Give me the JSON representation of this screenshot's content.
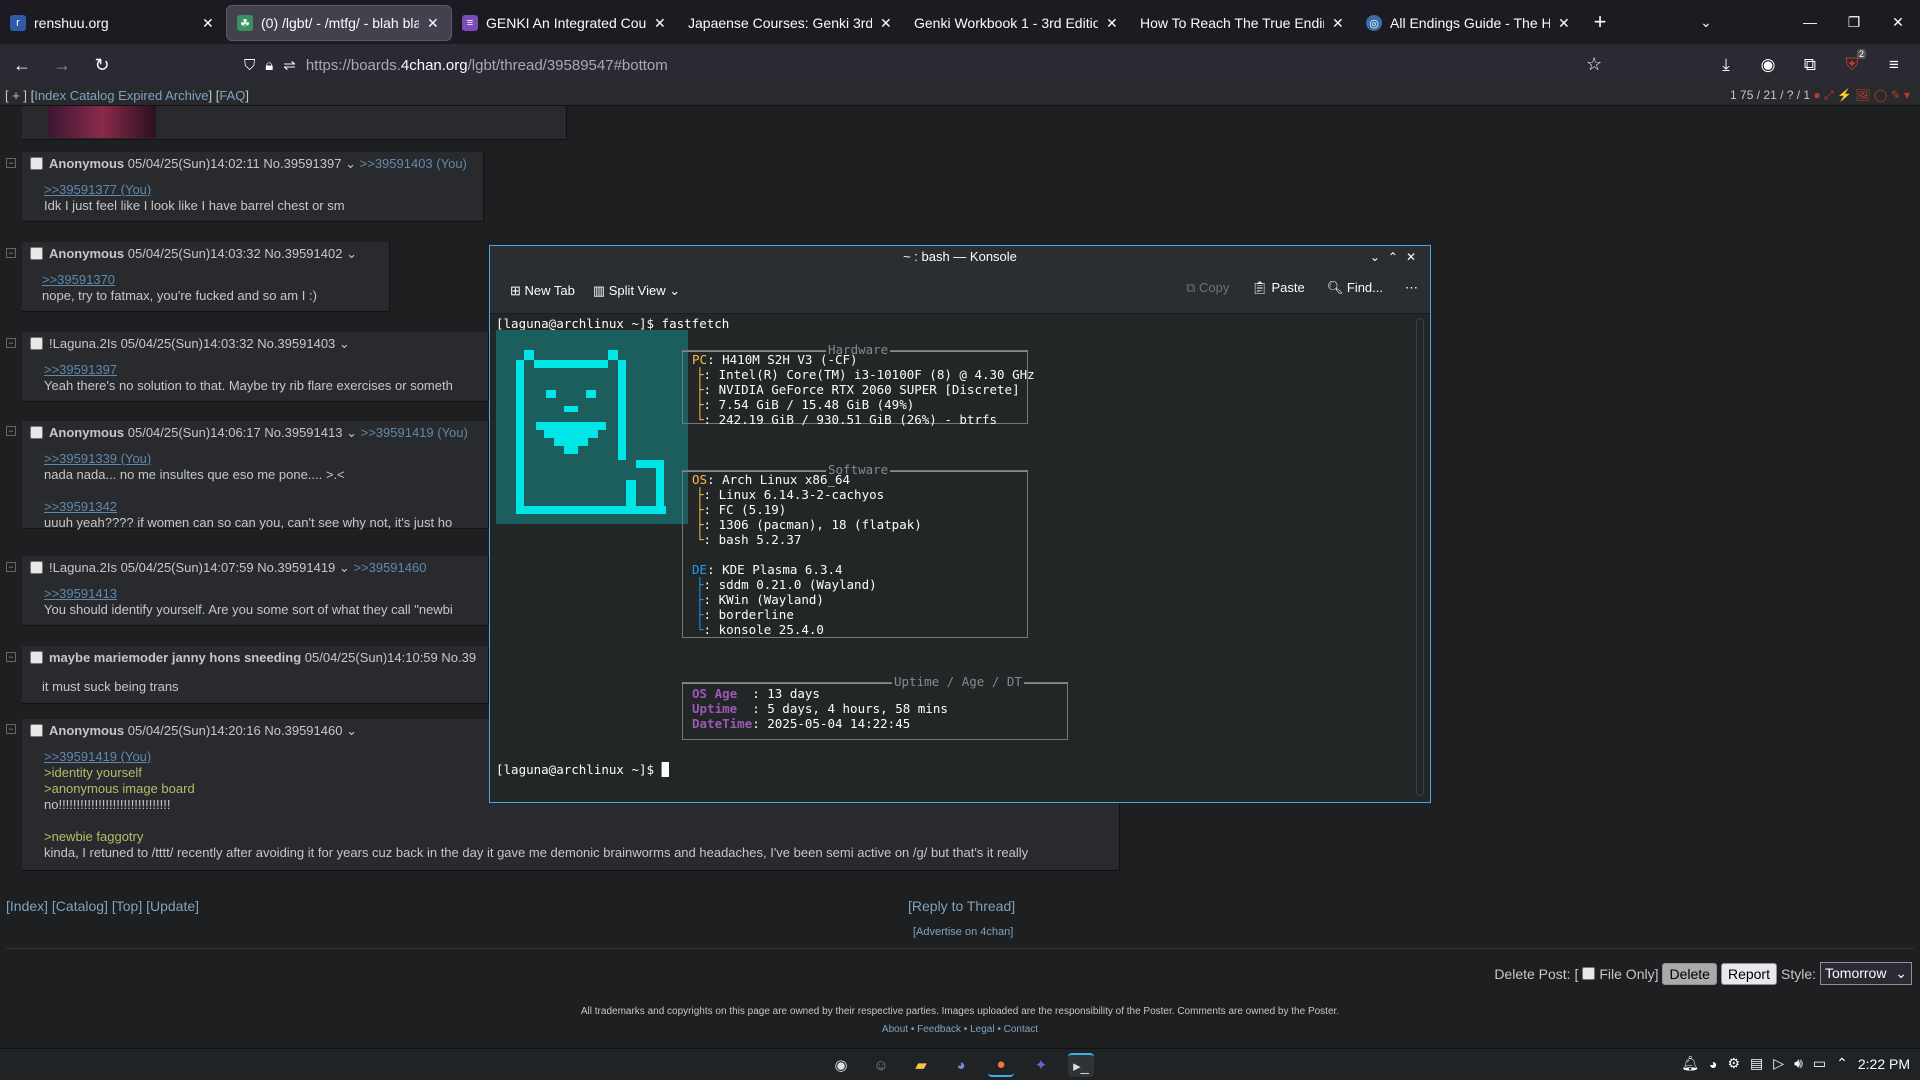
{
  "tabs": [
    {
      "label": "renshuu.org",
      "active": false
    },
    {
      "label": "(0) /lgbt/ - /mtfg/ - blah bla",
      "active": true
    },
    {
      "label": "GENKI An Integrated Cour",
      "active": false
    },
    {
      "label": "Japaense Courses: Genki 3rd e",
      "active": false
    },
    {
      "label": "Genki Workbook 1 - 3rd Edition",
      "active": false
    },
    {
      "label": "How To Reach The True Ending",
      "active": false
    },
    {
      "label": "All Endings Guide - The Hu",
      "active": false
    }
  ],
  "url": {
    "prefix": "https://boards.",
    "domain": "4chan.org",
    "path": "/lgbt/thread/39589547#bottom"
  },
  "topnav": {
    "left_open": "[ + ] [",
    "index": "Index",
    "catalog": "Catalog",
    "expired": "Expired",
    "archive": "Archive",
    "mid": "] [",
    "faq": "FAQ",
    "close": "]",
    "stats": "1 75 / 21 / ? / 1"
  },
  "posts": [
    {
      "name": "Anonymous",
      "date": "05/04/25(Sun)14:02:11",
      "no": "No.39591397",
      "backlinks": ">>39591403 (You)",
      "lines": [
        {
          "t": ">>39591377 (You)",
          "k": "ql"
        },
        {
          "t": "Idk I just feel like I look like I have barrel chest or sm",
          "k": "txt"
        }
      ]
    },
    {
      "name": "Anonymous",
      "date": "05/04/25(Sun)14:03:32",
      "no": "No.39591402",
      "backlinks": "",
      "lines": [
        {
          "t": ">>39591370",
          "k": "ql"
        },
        {
          "t": "nope, try to fatmax, you're fucked and so am I :)",
          "k": "txt"
        }
      ]
    },
    {
      "name": "!Laguna.2Is",
      "date": "05/04/25(Sun)14:03:32",
      "no": "No.39591403",
      "backlinks": "",
      "lines": [
        {
          "t": ">>39591397",
          "k": "ql"
        },
        {
          "t": "Yeah there's no solution to that. Maybe try rib flare exercises or someth",
          "k": "txt"
        }
      ]
    },
    {
      "name": "Anonymous",
      "date": "05/04/25(Sun)14:06:17",
      "no": "No.39591413",
      "backlinks": ">>39591419 (You)",
      "lines": [
        {
          "t": ">>39591339 (You)",
          "k": "ql"
        },
        {
          "t": "nada nada... no me insultes que eso me pone.... >.<",
          "k": "txt"
        },
        {
          "t": "",
          "k": "txt"
        },
        {
          "t": ">>39591342",
          "k": "ql"
        },
        {
          "t": "uuuh yeah???? if women can so can you, can't see why not, it's just ho",
          "k": "txt"
        }
      ]
    },
    {
      "name": "!Laguna.2Is",
      "date": "05/04/25(Sun)14:07:59",
      "no": "No.39591419",
      "backlinks": ">>39591460",
      "lines": [
        {
          "t": ">>39591413",
          "k": "ql"
        },
        {
          "t": "You should identify yourself. Are you some sort of what they call \"newbi",
          "k": "txt"
        }
      ]
    },
    {
      "name": "maybe mariemoder janny hons sneeding",
      "date": "05/04/25(Sun)14:10:59",
      "no": "No.39",
      "backlinks": "",
      "lines": [
        {
          "t": "it must suck being trans",
          "k": "txt"
        }
      ]
    },
    {
      "name": "Anonymous",
      "date": "05/04/25(Sun)14:20:16",
      "no": "No.39591460",
      "backlinks": "",
      "lines": [
        {
          "t": ">>39591419 (You)",
          "k": "ql"
        },
        {
          "t": ">identity yourself",
          "k": "gt"
        },
        {
          "t": ">anonymous image board",
          "k": "gt"
        },
        {
          "t": "no!!!!!!!!!!!!!!!!!!!!!!!!!!!!!!!",
          "k": "txt"
        },
        {
          "t": "",
          "k": "txt"
        },
        {
          "t": ">newbie faggotry",
          "k": "gt"
        },
        {
          "t": "kinda, I retuned to /tttt/ recently after avoiding it for years cuz back in the day it gave me demonic brainworms and headaches, I've been semi active on /g/ but that's it really",
          "k": "txt"
        }
      ]
    }
  ],
  "bottom": {
    "index": "[Index]",
    "catalog": "[Catalog]",
    "top": "[Top]",
    "update": "[Update]",
    "reply": "[Reply to Thread]",
    "advertise": "[Advertise on 4chan]",
    "delete_post": "Delete Post: [",
    "file_only": "File Only]",
    "delete": "Delete",
    "report": "Report",
    "style_label": "Style:",
    "style_value": "Tomorrow",
    "legal": "All trademarks and copyrights on this page are owned by their respective parties. Images uploaded are the responsibility of the Poster. Comments are owned by the Poster.",
    "footer_links": "About • Feedback • Legal • Contact"
  },
  "konsole": {
    "title": "~ : bash — Konsole",
    "toolbar": {
      "new_tab": "New Tab",
      "split_view": "Split View",
      "copy": "Copy",
      "paste": "Paste",
      "find": "Find..."
    },
    "prompt1": "[laguna@archlinux ~]$ fastfetch",
    "prompt2": "[laguna@archlinux ~]$ ",
    "hw_title": "Hardware",
    "hw": [
      {
        "k": "PC",
        "v": ": H410M S2H V3 (-CF)"
      },
      {
        "k": "├",
        "v": ": Intel(R) Core(TM) i3-10100F (8) @ 4.30 GHz"
      },
      {
        "k": "├",
        "v": ": NVIDIA GeForce RTX 2060 SUPER [Discrete]"
      },
      {
        "k": "├",
        "v": ": 7.54 GiB / 15.48 GiB (49%)"
      },
      {
        "k": "└",
        "v": ": 242.19 GiB / 930.51 GiB (26%) - btrfs"
      }
    ],
    "sw_title": "Software",
    "sw": [
      {
        "k": "OS",
        "v": ": Arch Linux x86_64"
      },
      {
        "k": "├",
        "v": ": Linux 6.14.3-2-cachyos"
      },
      {
        "k": "├",
        "v": ": FC (5.19)"
      },
      {
        "k": "├",
        "v": ": 1306 (pacman), 18 (flatpak)"
      },
      {
        "k": "└",
        "v": ": bash 5.2.37"
      }
    ],
    "de": [
      {
        "k": "DE",
        "v": ": KDE Plasma 6.3.4"
      },
      {
        "k": "├",
        "v": ": sddm 0.21.0 (Wayland)"
      },
      {
        "k": "├",
        "v": ": KWin (Wayland)"
      },
      {
        "k": "├",
        "v": ": borderline"
      },
      {
        "k": "└",
        "v": ": konsole 25.4.0"
      }
    ],
    "up_title": "Uptime / Age / DT",
    "up": [
      {
        "k": "OS Age",
        "v": "  : 13 days"
      },
      {
        "k": "Uptime",
        "v": "  : 5 days, 4 hours, 58 mins"
      },
      {
        "k": "DateTime",
        "v": ": 2025-05-04 14:22:45"
      }
    ]
  },
  "taskbar": {
    "clock": "2:22 PM",
    "badge": "2"
  }
}
